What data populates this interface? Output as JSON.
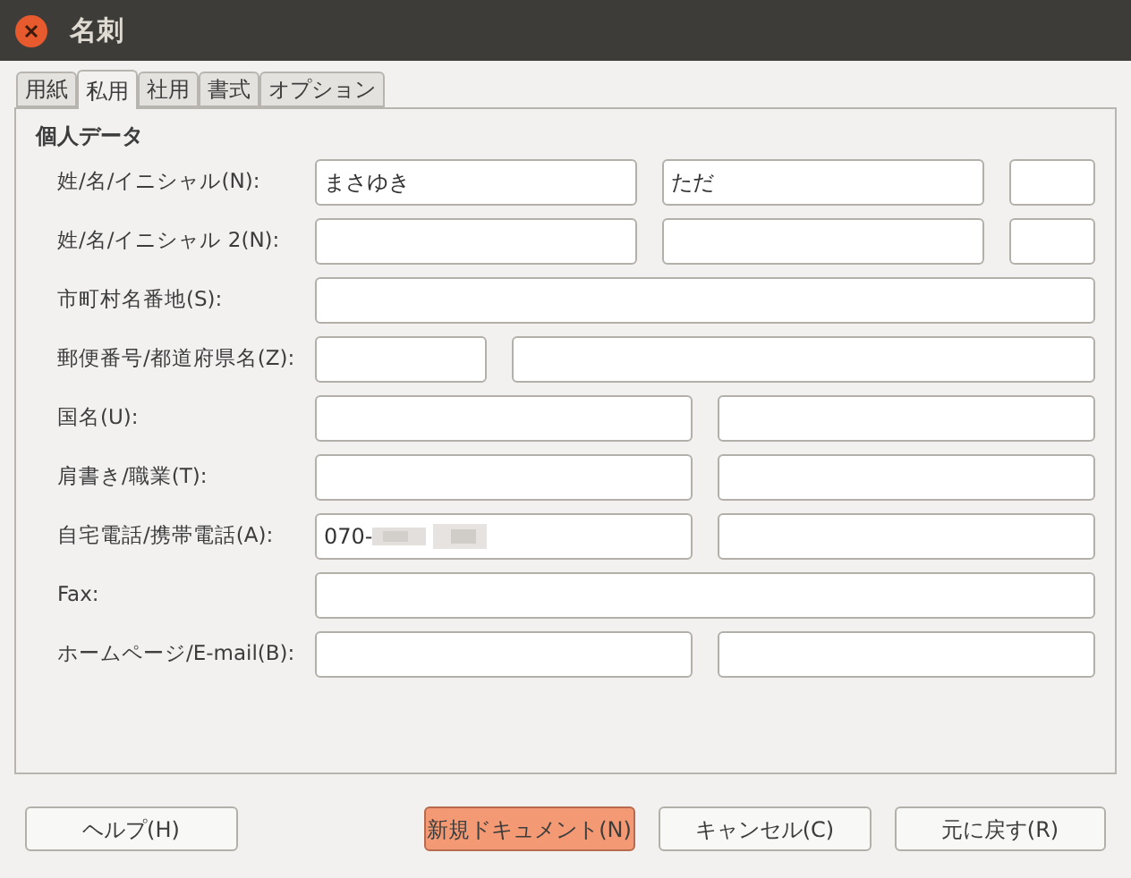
{
  "window": {
    "title": "名刺"
  },
  "tabs": [
    {
      "label": "用紙",
      "selected": false
    },
    {
      "label": "私用",
      "selected": true
    },
    {
      "label": "社用",
      "selected": false
    },
    {
      "label": "書式",
      "selected": false
    },
    {
      "label": "オプション",
      "selected": false
    }
  ],
  "section": {
    "title": "個人データ"
  },
  "rows": [
    {
      "label": "姓/名/イニシャル(N):",
      "kind": "triple",
      "first_value": "まさゆき",
      "second_value": "ただ"
    },
    {
      "label": "姓/名/イニシャル 2(N):",
      "kind": "triple"
    },
    {
      "label": "市町村名番地(S):",
      "kind": "single"
    },
    {
      "label": "郵便番号/都道府県名(Z):",
      "kind": "postal"
    },
    {
      "label": "国名(U):",
      "kind": "pair"
    },
    {
      "label": "肩書き/職業(T):",
      "kind": "pair"
    },
    {
      "label": "自宅電話/携帯電話(A):",
      "kind": "pair",
      "first_value": "070-",
      "first_redacted": true
    },
    {
      "label": "Fax:",
      "kind": "single"
    },
    {
      "label": "ホームページ/E-mail(B):",
      "kind": "pair"
    }
  ],
  "buttons": [
    {
      "label": "ヘルプ(H)",
      "default": false
    },
    {
      "label": "新規ドキュメント(N)",
      "default": true
    },
    {
      "label": "キャンセル(C)",
      "default": false
    },
    {
      "label": "元に戻す(R)",
      "default": false
    }
  ]
}
